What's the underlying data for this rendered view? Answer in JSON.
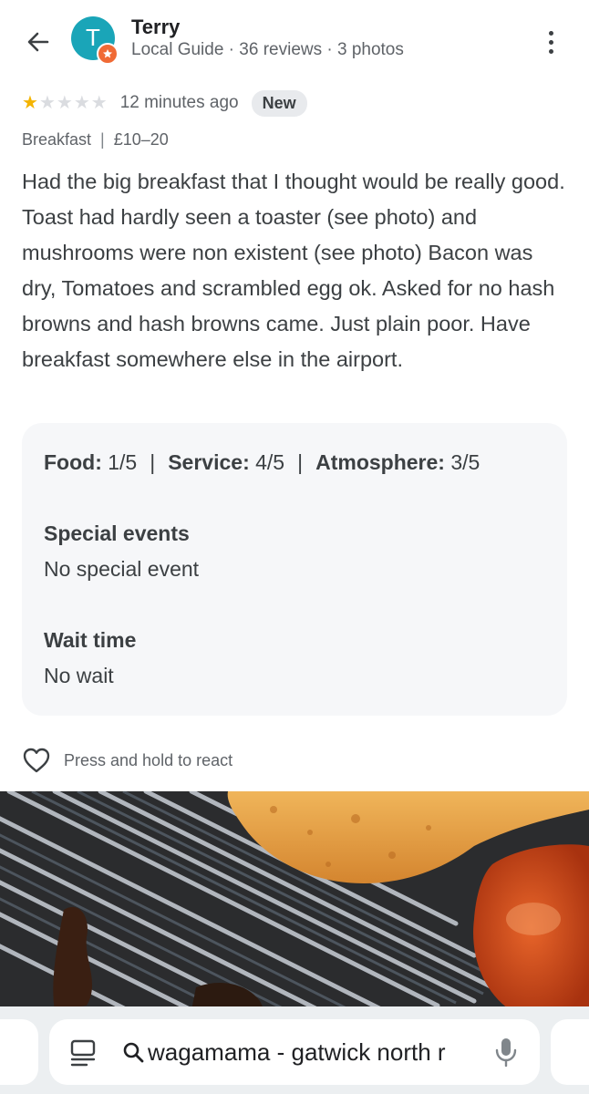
{
  "header": {
    "avatar_letter": "T",
    "user_name": "Terry",
    "user_meta": "Local Guide · 36 reviews · 3 photos"
  },
  "review": {
    "rating": 1,
    "rating_max": 5,
    "time": "12 minutes ago",
    "badge": "New",
    "meal": "Breakfast",
    "meta_separator": "|",
    "price": "£10–20",
    "text": "Had the big breakfast that I thought would be really good. Toast had hardly seen a toaster (see photo) and mushrooms were non existent (see photo) Bacon was dry, Tomatoes and scrambled egg ok. Asked for no hash browns and hash browns came. Just plain poor. Have breakfast somewhere else in the airport."
  },
  "attributes": {
    "scores": [
      {
        "label": "Food:",
        "value": "1/5"
      },
      {
        "label": "Service:",
        "value": "4/5"
      },
      {
        "label": "Atmosphere:",
        "value": "3/5"
      }
    ],
    "score_separator": "|",
    "special_events": {
      "title": "Special events",
      "value": "No special event"
    },
    "wait_time": {
      "title": "Wait time",
      "value": "No wait"
    }
  },
  "react": {
    "label": "Press and hold to react"
  },
  "search_bar": {
    "query": "wagamama - gatwick north r"
  },
  "colors": {
    "avatar": "#1aa5b8",
    "guide_badge": "#f06a35",
    "star_on": "#f4b400",
    "star_off": "#dadce0",
    "card_bg": "#f6f7f9"
  },
  "icons": {
    "back": "back-arrow-icon",
    "more": "more-vert-icon",
    "guide": "local-guide-star-icon",
    "react": "heart-outline-icon",
    "page": "page-lines-icon",
    "search": "search-icon",
    "mic": "mic-icon"
  }
}
